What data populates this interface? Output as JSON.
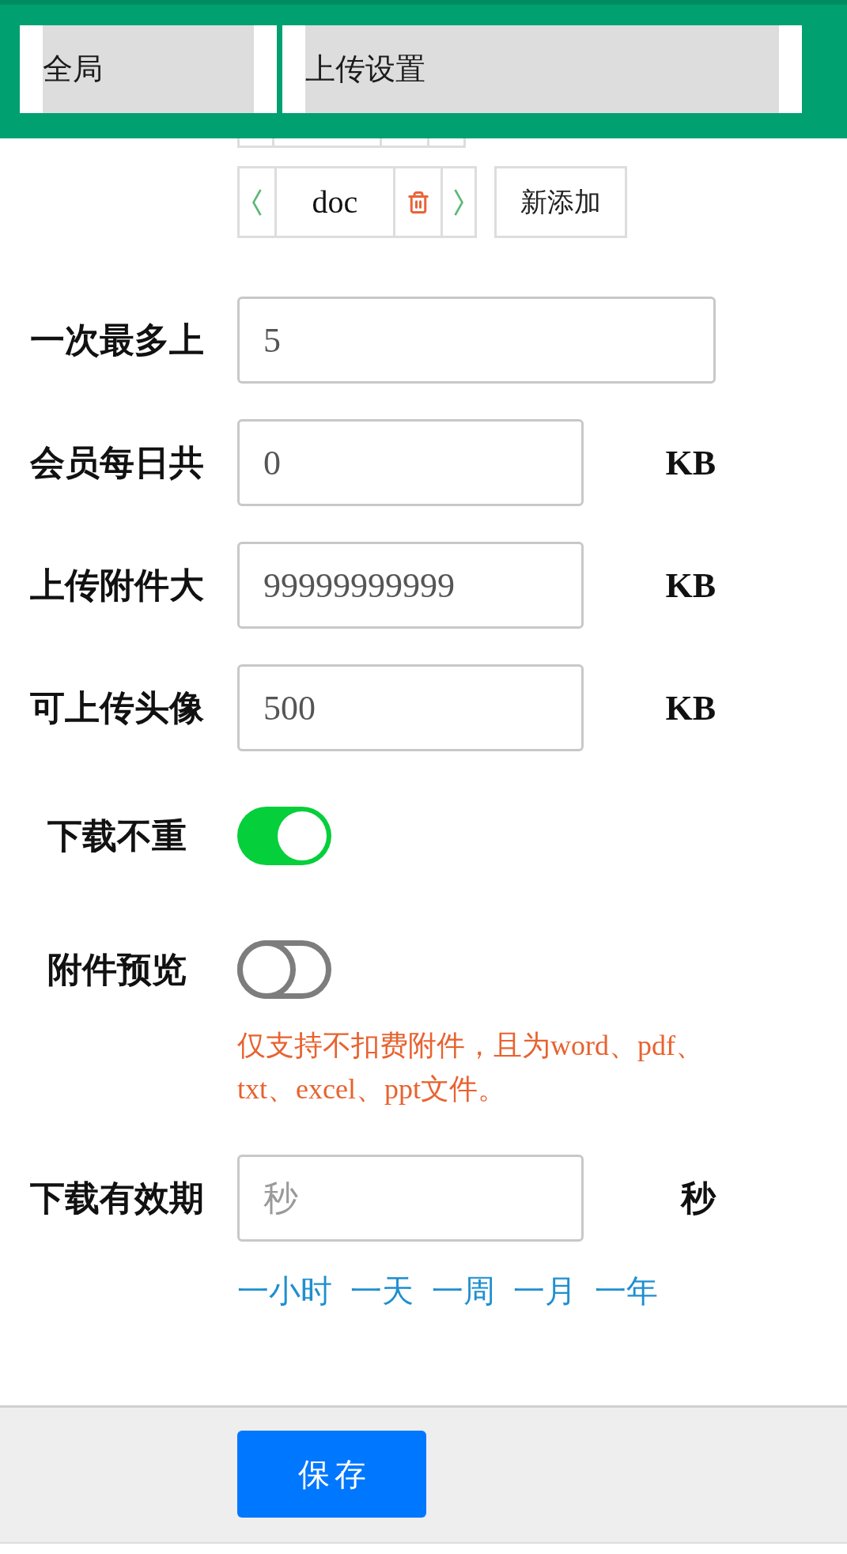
{
  "header": {
    "selects": [
      {
        "value": "全局"
      },
      {
        "value": "上传设置"
      }
    ]
  },
  "extensions": {
    "tags": [
      {
        "label": "doc"
      }
    ],
    "add_button": "新添加"
  },
  "fields": [
    {
      "kind": "input",
      "label": "一次最多上",
      "value": "5"
    },
    {
      "kind": "input",
      "label": "会员每日共",
      "value": "0",
      "unit": "KB"
    },
    {
      "kind": "input",
      "label": "上传附件大",
      "value": "99999999999",
      "unit": "KB"
    },
    {
      "kind": "input",
      "label": "可上传头像",
      "value": "500",
      "unit": "KB"
    },
    {
      "kind": "toggle",
      "label": "下载不重",
      "on": true
    },
    {
      "kind": "toggle",
      "label": "附件预览",
      "on": false,
      "hint": "仅支持不扣费附件，且为word、pdf、txt、excel、ppt文件。"
    },
    {
      "kind": "input",
      "label": "下载有效期",
      "placeholder": "秒",
      "unit": "秒",
      "quick_options": [
        "一小时",
        "一天",
        "一周",
        "一月",
        "一年"
      ]
    }
  ],
  "save_button": "保存"
}
